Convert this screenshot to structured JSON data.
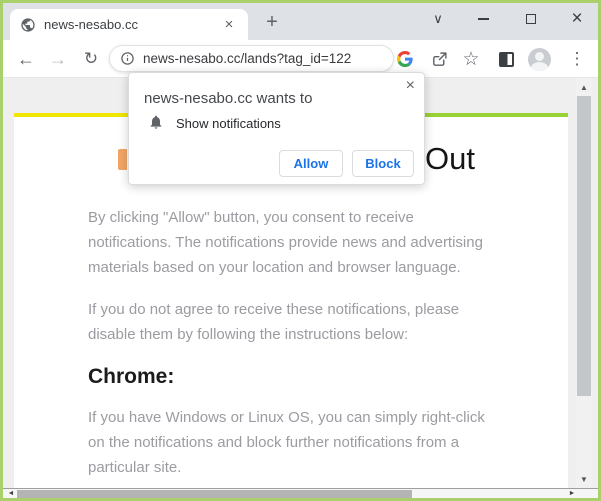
{
  "colors": {
    "frame_green": "#a9d06a",
    "tabbar_bg": "#dee1e6",
    "accent_blue": "#1a73e8",
    "stripe_yellow": "#efe603",
    "stripe_green": "#98d236",
    "body_text_gray": "#9b9ba1"
  },
  "tabbar": {
    "tab_title": "news-nesabo.cc",
    "tab_close_glyph": "×",
    "new_tab_glyph": "+"
  },
  "window_controls": {
    "menu_chevron_glyph": "∨",
    "close_glyph": "×"
  },
  "toolbar": {
    "back_glyph": "←",
    "forward_glyph": "→",
    "reload_glyph": "↻",
    "url": "news-nesabo.cc/lands?tag_id=122",
    "bookmark_glyph": "☆",
    "menu_glyph": "⋮"
  },
  "permission_popup": {
    "title": "news-nesabo.cc wants to",
    "permission_label": "Show notifications",
    "allow_label": "Allow",
    "block_label": "Block",
    "close_glyph": "×"
  },
  "page": {
    "heading_visible": "Out",
    "intro": "By clicking \"Allow\" button, you consent to receive\nnotifications. The notifications provide news and advertising\nmaterials based on your location and browser language.",
    "disagree": "If you do not agree to receive these notifications, please\ndisable them by following the instructions below:",
    "browser_heading": "Chrome:",
    "chrome_instructions": "If you have Windows or Linux OS, you can simply right-click\non the notifications and block further notifications from a\nparticular site."
  },
  "scrollbars": {
    "up_glyph": "▲",
    "down_glyph": "▼",
    "left_glyph": "◄",
    "right_glyph": "►"
  }
}
